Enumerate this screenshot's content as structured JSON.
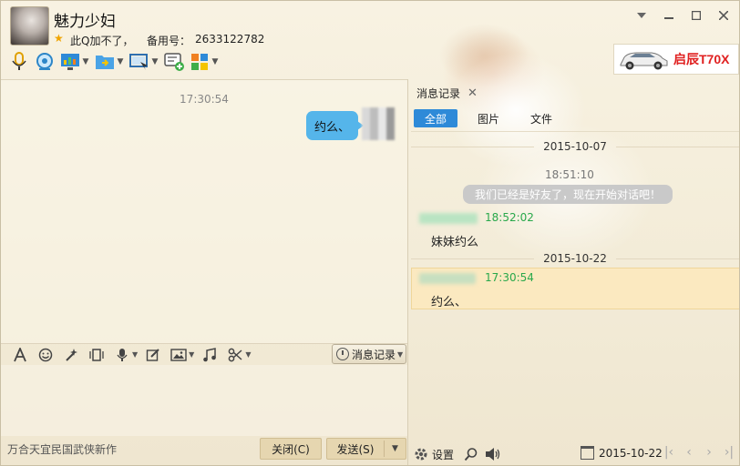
{
  "contact": {
    "name": "魅力少妇",
    "status_text": "此Q加不了，",
    "alias_label": "备用号：",
    "alias_value": "2633122782"
  },
  "window_controls": [
    "dropdown-icon",
    "minimize-icon",
    "maximize-icon",
    "close-icon"
  ],
  "toolbar_icons": [
    "voice-call-icon",
    "video-call-icon",
    "screen-share-icon",
    "file-transfer-icon",
    "remote-assist-icon",
    "create-discussion-icon",
    "apps-icon"
  ],
  "ad": {
    "text": "启辰T70X"
  },
  "chat": {
    "timestamp": "17:30:54",
    "messages": [
      {
        "from": "self",
        "text": "约么、"
      }
    ]
  },
  "input_toolbar": {
    "icons": [
      "font-icon",
      "emoji-icon",
      "magic-icon",
      "shake-icon",
      "voice-message-icon",
      "edit-icon",
      "image-icon",
      "music-icon",
      "scissors-icon"
    ],
    "history_button": "消息记录"
  },
  "footer": {
    "ad_text": "万合天宜民国武侠新作",
    "close_button": "关闭(C)",
    "send_button": "发送(S)"
  },
  "history_panel": {
    "tab_title": "消息记录",
    "filters": [
      "全部",
      "图片",
      "文件"
    ],
    "active_filter": "全部",
    "entries": {
      "date1": "2015-10-07",
      "time1": "18:51:10",
      "system_message": "我们已经是好友了，现在开始对话吧！",
      "time2": "18:52:02",
      "message2": "妹妹约么",
      "date2": "2015-10-22",
      "time3": "17:30:54",
      "message3": "约么、"
    },
    "bottom": {
      "settings_label": "设置",
      "date": "2015-10-22"
    }
  },
  "colors": {
    "accent_blue": "#2e8ad8",
    "bubble_blue": "#55b5ea",
    "green_time": "#29a84b",
    "highlight": "#fbe9c0"
  }
}
